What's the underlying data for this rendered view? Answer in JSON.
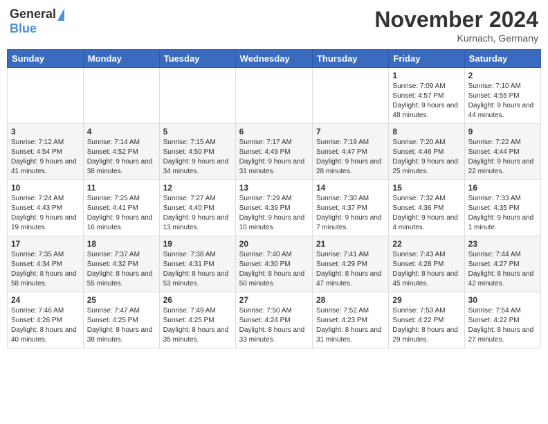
{
  "header": {
    "logo_general": "General",
    "logo_blue": "Blue",
    "month_title": "November 2024",
    "location": "Kurnach, Germany"
  },
  "weekdays": [
    "Sunday",
    "Monday",
    "Tuesday",
    "Wednesday",
    "Thursday",
    "Friday",
    "Saturday"
  ],
  "weeks": [
    [
      {
        "day": "",
        "info": ""
      },
      {
        "day": "",
        "info": ""
      },
      {
        "day": "",
        "info": ""
      },
      {
        "day": "",
        "info": ""
      },
      {
        "day": "",
        "info": ""
      },
      {
        "day": "1",
        "info": "Sunrise: 7:09 AM\nSunset: 4:57 PM\nDaylight: 9 hours and 48 minutes."
      },
      {
        "day": "2",
        "info": "Sunrise: 7:10 AM\nSunset: 4:55 PM\nDaylight: 9 hours and 44 minutes."
      }
    ],
    [
      {
        "day": "3",
        "info": "Sunrise: 7:12 AM\nSunset: 4:54 PM\nDaylight: 9 hours and 41 minutes."
      },
      {
        "day": "4",
        "info": "Sunrise: 7:14 AM\nSunset: 4:52 PM\nDaylight: 9 hours and 38 minutes."
      },
      {
        "day": "5",
        "info": "Sunrise: 7:15 AM\nSunset: 4:50 PM\nDaylight: 9 hours and 34 minutes."
      },
      {
        "day": "6",
        "info": "Sunrise: 7:17 AM\nSunset: 4:49 PM\nDaylight: 9 hours and 31 minutes."
      },
      {
        "day": "7",
        "info": "Sunrise: 7:19 AM\nSunset: 4:47 PM\nDaylight: 9 hours and 28 minutes."
      },
      {
        "day": "8",
        "info": "Sunrise: 7:20 AM\nSunset: 4:46 PM\nDaylight: 9 hours and 25 minutes."
      },
      {
        "day": "9",
        "info": "Sunrise: 7:22 AM\nSunset: 4:44 PM\nDaylight: 9 hours and 22 minutes."
      }
    ],
    [
      {
        "day": "10",
        "info": "Sunrise: 7:24 AM\nSunset: 4:43 PM\nDaylight: 9 hours and 19 minutes."
      },
      {
        "day": "11",
        "info": "Sunrise: 7:25 AM\nSunset: 4:41 PM\nDaylight: 9 hours and 16 minutes."
      },
      {
        "day": "12",
        "info": "Sunrise: 7:27 AM\nSunset: 4:40 PM\nDaylight: 9 hours and 13 minutes."
      },
      {
        "day": "13",
        "info": "Sunrise: 7:29 AM\nSunset: 4:39 PM\nDaylight: 9 hours and 10 minutes."
      },
      {
        "day": "14",
        "info": "Sunrise: 7:30 AM\nSunset: 4:37 PM\nDaylight: 9 hours and 7 minutes."
      },
      {
        "day": "15",
        "info": "Sunrise: 7:32 AM\nSunset: 4:36 PM\nDaylight: 9 hours and 4 minutes."
      },
      {
        "day": "16",
        "info": "Sunrise: 7:33 AM\nSunset: 4:35 PM\nDaylight: 9 hours and 1 minute."
      }
    ],
    [
      {
        "day": "17",
        "info": "Sunrise: 7:35 AM\nSunset: 4:34 PM\nDaylight: 8 hours and 58 minutes."
      },
      {
        "day": "18",
        "info": "Sunrise: 7:37 AM\nSunset: 4:32 PM\nDaylight: 8 hours and 55 minutes."
      },
      {
        "day": "19",
        "info": "Sunrise: 7:38 AM\nSunset: 4:31 PM\nDaylight: 8 hours and 53 minutes."
      },
      {
        "day": "20",
        "info": "Sunrise: 7:40 AM\nSunset: 4:30 PM\nDaylight: 8 hours and 50 minutes."
      },
      {
        "day": "21",
        "info": "Sunrise: 7:41 AM\nSunset: 4:29 PM\nDaylight: 8 hours and 47 minutes."
      },
      {
        "day": "22",
        "info": "Sunrise: 7:43 AM\nSunset: 4:28 PM\nDaylight: 8 hours and 45 minutes."
      },
      {
        "day": "23",
        "info": "Sunrise: 7:44 AM\nSunset: 4:27 PM\nDaylight: 8 hours and 42 minutes."
      }
    ],
    [
      {
        "day": "24",
        "info": "Sunrise: 7:46 AM\nSunset: 4:26 PM\nDaylight: 8 hours and 40 minutes."
      },
      {
        "day": "25",
        "info": "Sunrise: 7:47 AM\nSunset: 4:25 PM\nDaylight: 8 hours and 38 minutes."
      },
      {
        "day": "26",
        "info": "Sunrise: 7:49 AM\nSunset: 4:25 PM\nDaylight: 8 hours and 35 minutes."
      },
      {
        "day": "27",
        "info": "Sunrise: 7:50 AM\nSunset: 4:24 PM\nDaylight: 8 hours and 33 minutes."
      },
      {
        "day": "28",
        "info": "Sunrise: 7:52 AM\nSunset: 4:23 PM\nDaylight: 8 hours and 31 minutes."
      },
      {
        "day": "29",
        "info": "Sunrise: 7:53 AM\nSunset: 4:22 PM\nDaylight: 8 hours and 29 minutes."
      },
      {
        "day": "30",
        "info": "Sunrise: 7:54 AM\nSunset: 4:22 PM\nDaylight: 8 hours and 27 minutes."
      }
    ]
  ]
}
